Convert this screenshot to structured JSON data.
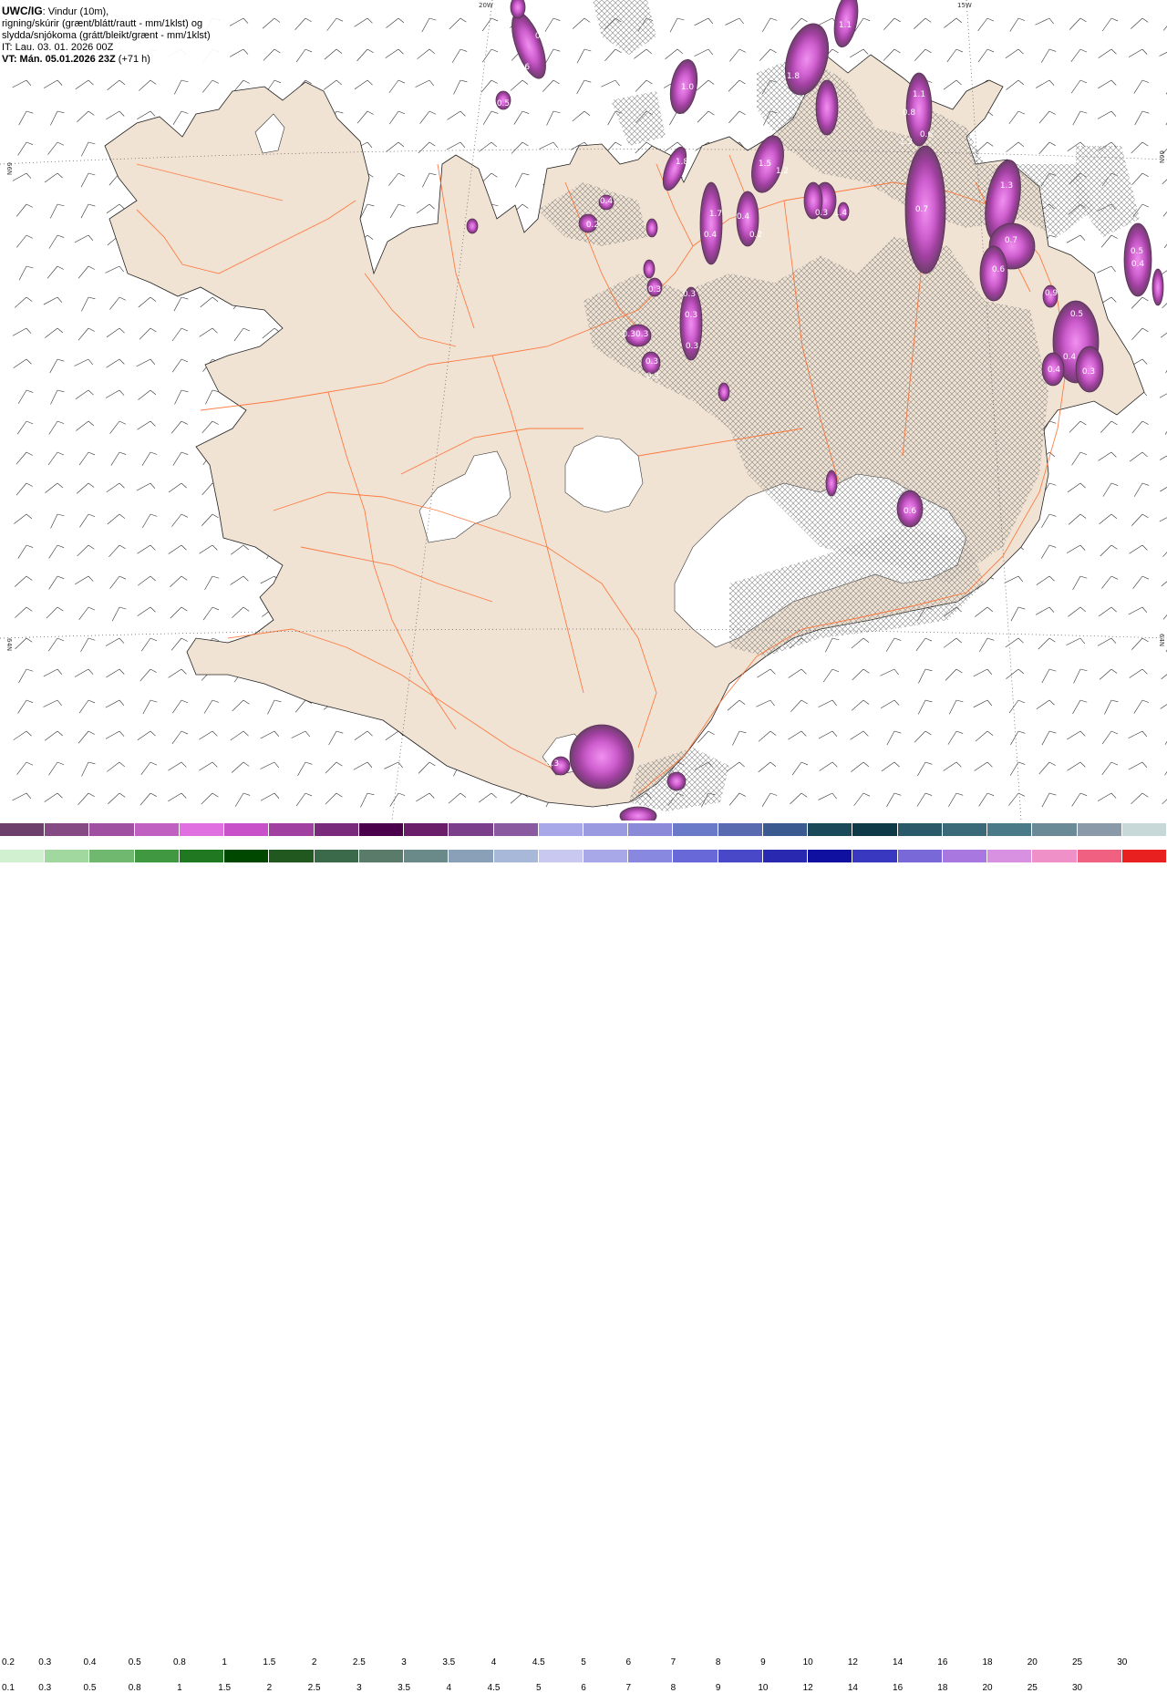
{
  "info": {
    "model": "UWC/IG",
    "line1_rest": ": Vindur (10m),",
    "line2": "rigning/skúrir (grænt/blátt/rautt - mm/1klst) og",
    "line3": "slydda/snjókoma (grátt/bleikt/grænt - mm/1klst)",
    "it": "IT: Lau. 03. 01. 2026 00Z",
    "vt_label": "VT: Mán. 05.01.2026 23Z",
    "vt_offset": "(+71 h)"
  },
  "grid_labels": {
    "top": [
      "20W",
      "15W"
    ],
    "left": [
      "66N",
      "64N"
    ],
    "right": [
      "66N",
      "64N"
    ]
  },
  "precip_labels": [
    "0.6",
    "0.6",
    "0.5",
    "1.0",
    "1.8",
    "1.1",
    "1.1",
    "0.8",
    "0.6",
    "1.3",
    "1.8",
    "1.5",
    "1.2",
    "1.7",
    "0.4",
    "0.4",
    "0.2",
    "0.3",
    "1.4",
    "0.7",
    "1.3",
    "0.7",
    "0.6",
    "0.5",
    "0.4",
    "0.9",
    "0.5",
    "0.4",
    "0.3",
    "0.4",
    "0.3",
    "0.3",
    "0.3",
    "0.3",
    "0.30.3",
    "0.3",
    "0.3",
    "0.2",
    "0.4",
    "0.6",
    "0.3"
  ],
  "legend": {
    "snow": {
      "labels": [
        "0.2",
        "0.3",
        "0.4",
        "0.5",
        "0.8",
        "1",
        "1.5",
        "2",
        "2.5",
        "3",
        "3.5",
        "4",
        "4.5",
        "5",
        "6",
        "7",
        "8",
        "9",
        "10",
        "12",
        "14",
        "16",
        "18",
        "20",
        "25",
        "30"
      ],
      "colors": [
        "#6d3f6b",
        "#854a83",
        "#a050a0",
        "#c060c0",
        "#e070e0",
        "#c850c8",
        "#a040a0",
        "#7a2a7a",
        "#4a004a",
        "#6a1e6a",
        "#7a3e8a",
        "#8a5aa0",
        "#a8a8e8",
        "#9a9ae0",
        "#8a8ad8",
        "#6a7ac8",
        "#5a6ab0",
        "#3a5a90",
        "#1a4a5a",
        "#0e3a48",
        "#2a5a6a",
        "#3a6a78",
        "#4a7a88",
        "#6a8a98",
        "#8a9aa8",
        "#c8d8d8"
      ]
    },
    "rain": {
      "labels": [
        "0.1",
        "0.3",
        "0.5",
        "0.8",
        "1",
        "1.5",
        "2",
        "2.5",
        "3",
        "3.5",
        "4",
        "4.5",
        "5",
        "6",
        "7",
        "8",
        "9",
        "10",
        "12",
        "14",
        "16",
        "18",
        "20",
        "25",
        "30"
      ],
      "colors": [
        "#d0f0d0",
        "#a0d8a0",
        "#70b870",
        "#409840",
        "#207820",
        "#004800",
        "#205820",
        "#3a6a4a",
        "#5a7a6a",
        "#6a8a8a",
        "#8aa0b8",
        "#a8b8d8",
        "#c8c8f0",
        "#a8a8e8",
        "#8888e0",
        "#6868d8",
        "#4848c8",
        "#2828b0",
        "#1010a0",
        "#3838c0",
        "#7868d8",
        "#a878e0",
        "#d890e0",
        "#f090c8",
        "#f06080",
        "#e82020"
      ]
    }
  }
}
